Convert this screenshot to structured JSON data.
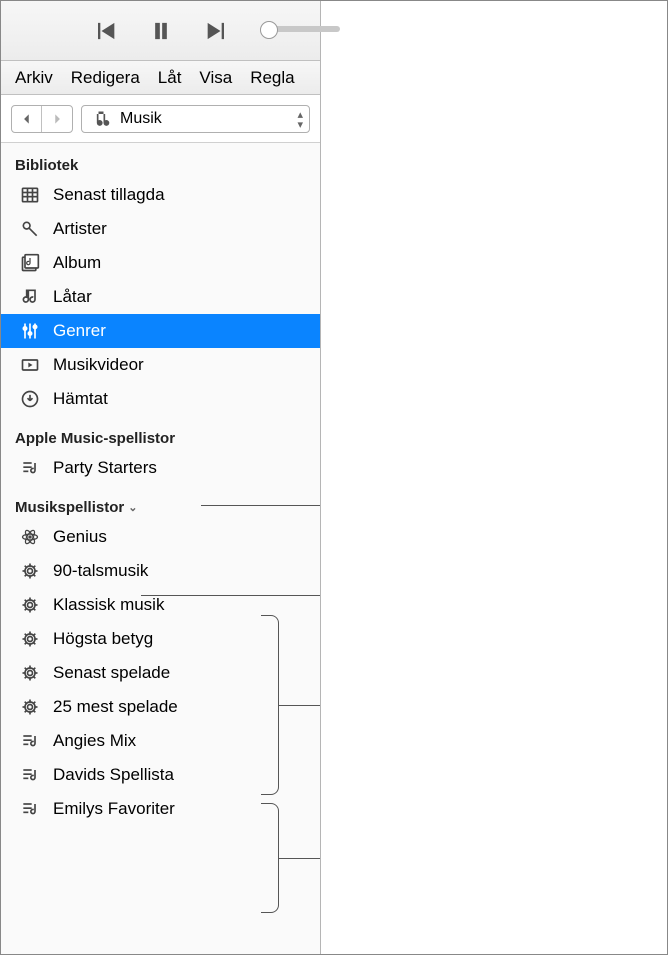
{
  "menubar": {
    "items": [
      "Arkiv",
      "Redigera",
      "Låt",
      "Visa",
      "Regla"
    ]
  },
  "source": {
    "label": "Musik"
  },
  "sections": {
    "library": {
      "title": "Bibliotek",
      "items": [
        {
          "icon": "recent",
          "label": "Senast tillagda"
        },
        {
          "icon": "mic",
          "label": "Artister"
        },
        {
          "icon": "album",
          "label": "Album"
        },
        {
          "icon": "note",
          "label": "Låtar"
        },
        {
          "icon": "sliders",
          "label": "Genrer",
          "selected": true
        },
        {
          "icon": "video",
          "label": "Musikvideor"
        },
        {
          "icon": "download",
          "label": "Hämtat"
        }
      ]
    },
    "appleMusic": {
      "title": "Apple Music-spellistor",
      "items": [
        {
          "icon": "playlist",
          "label": "Party Starters"
        }
      ]
    },
    "playlists": {
      "title": "Musikspellistor",
      "items": [
        {
          "icon": "genius",
          "label": "Genius"
        },
        {
          "icon": "gear",
          "label": "90-talsmusik"
        },
        {
          "icon": "gear",
          "label": "Klassisk musik"
        },
        {
          "icon": "gear",
          "label": "Högsta betyg"
        },
        {
          "icon": "gear",
          "label": "Senast spelade"
        },
        {
          "icon": "gear",
          "label": "25 mest spelade"
        },
        {
          "icon": "playlist",
          "label": "Angies Mix"
        },
        {
          "icon": "playlist",
          "label": "Davids Spellista"
        },
        {
          "icon": "playlist",
          "label": "Emilys Favoriter"
        }
      ]
    }
  }
}
